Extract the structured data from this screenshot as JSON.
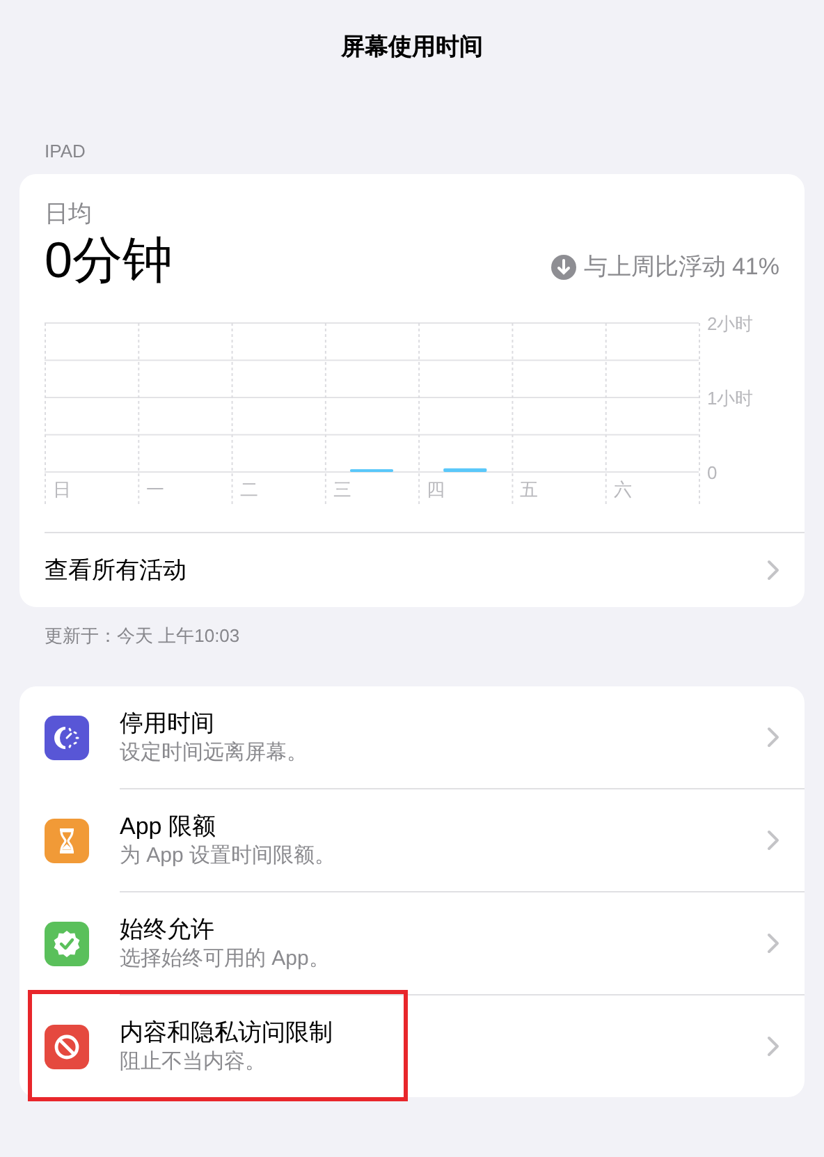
{
  "nav": {
    "title": "屏幕使用时间"
  },
  "section_header": "IPAD",
  "summary": {
    "label": "日均",
    "value": "0分钟",
    "trend": {
      "kind": "down",
      "text": "与上周比浮动 41%"
    },
    "chart_data": {
      "type": "bar",
      "categories": [
        "日",
        "一",
        "二",
        "三",
        "四",
        "五",
        "六"
      ],
      "series": [
        {
          "color": "#5ac8fa",
          "values": [
            0,
            0,
            0,
            0.01,
            0.02,
            0,
            0
          ]
        }
      ],
      "ylim": [
        0,
        2
      ],
      "yticks": [
        {
          "value": 0,
          "label": "0"
        },
        {
          "value": 1,
          "label": "1小时"
        },
        {
          "value": 2,
          "label": "2小时"
        }
      ]
    },
    "link": "查看所有活动"
  },
  "updated": "更新于：今天 上午10:03",
  "settings": [
    {
      "kind": "downtime",
      "color": "#5856d6",
      "title": "停用时间",
      "subtitle": "设定时间远离屏幕。",
      "highlighted": false
    },
    {
      "kind": "limits",
      "color": "#f19a37",
      "title": "App 限额",
      "subtitle": "为 App 设置时间限额。",
      "highlighted": false
    },
    {
      "kind": "allowed",
      "color": "#5ac05b",
      "title": "始终允许",
      "subtitle": "选择始终可用的 App。",
      "highlighted": false
    },
    {
      "kind": "restrictions",
      "color": "#e5493f",
      "title": "内容和隐私访问限制",
      "subtitle": "阻止不当内容。",
      "highlighted": true
    }
  ]
}
